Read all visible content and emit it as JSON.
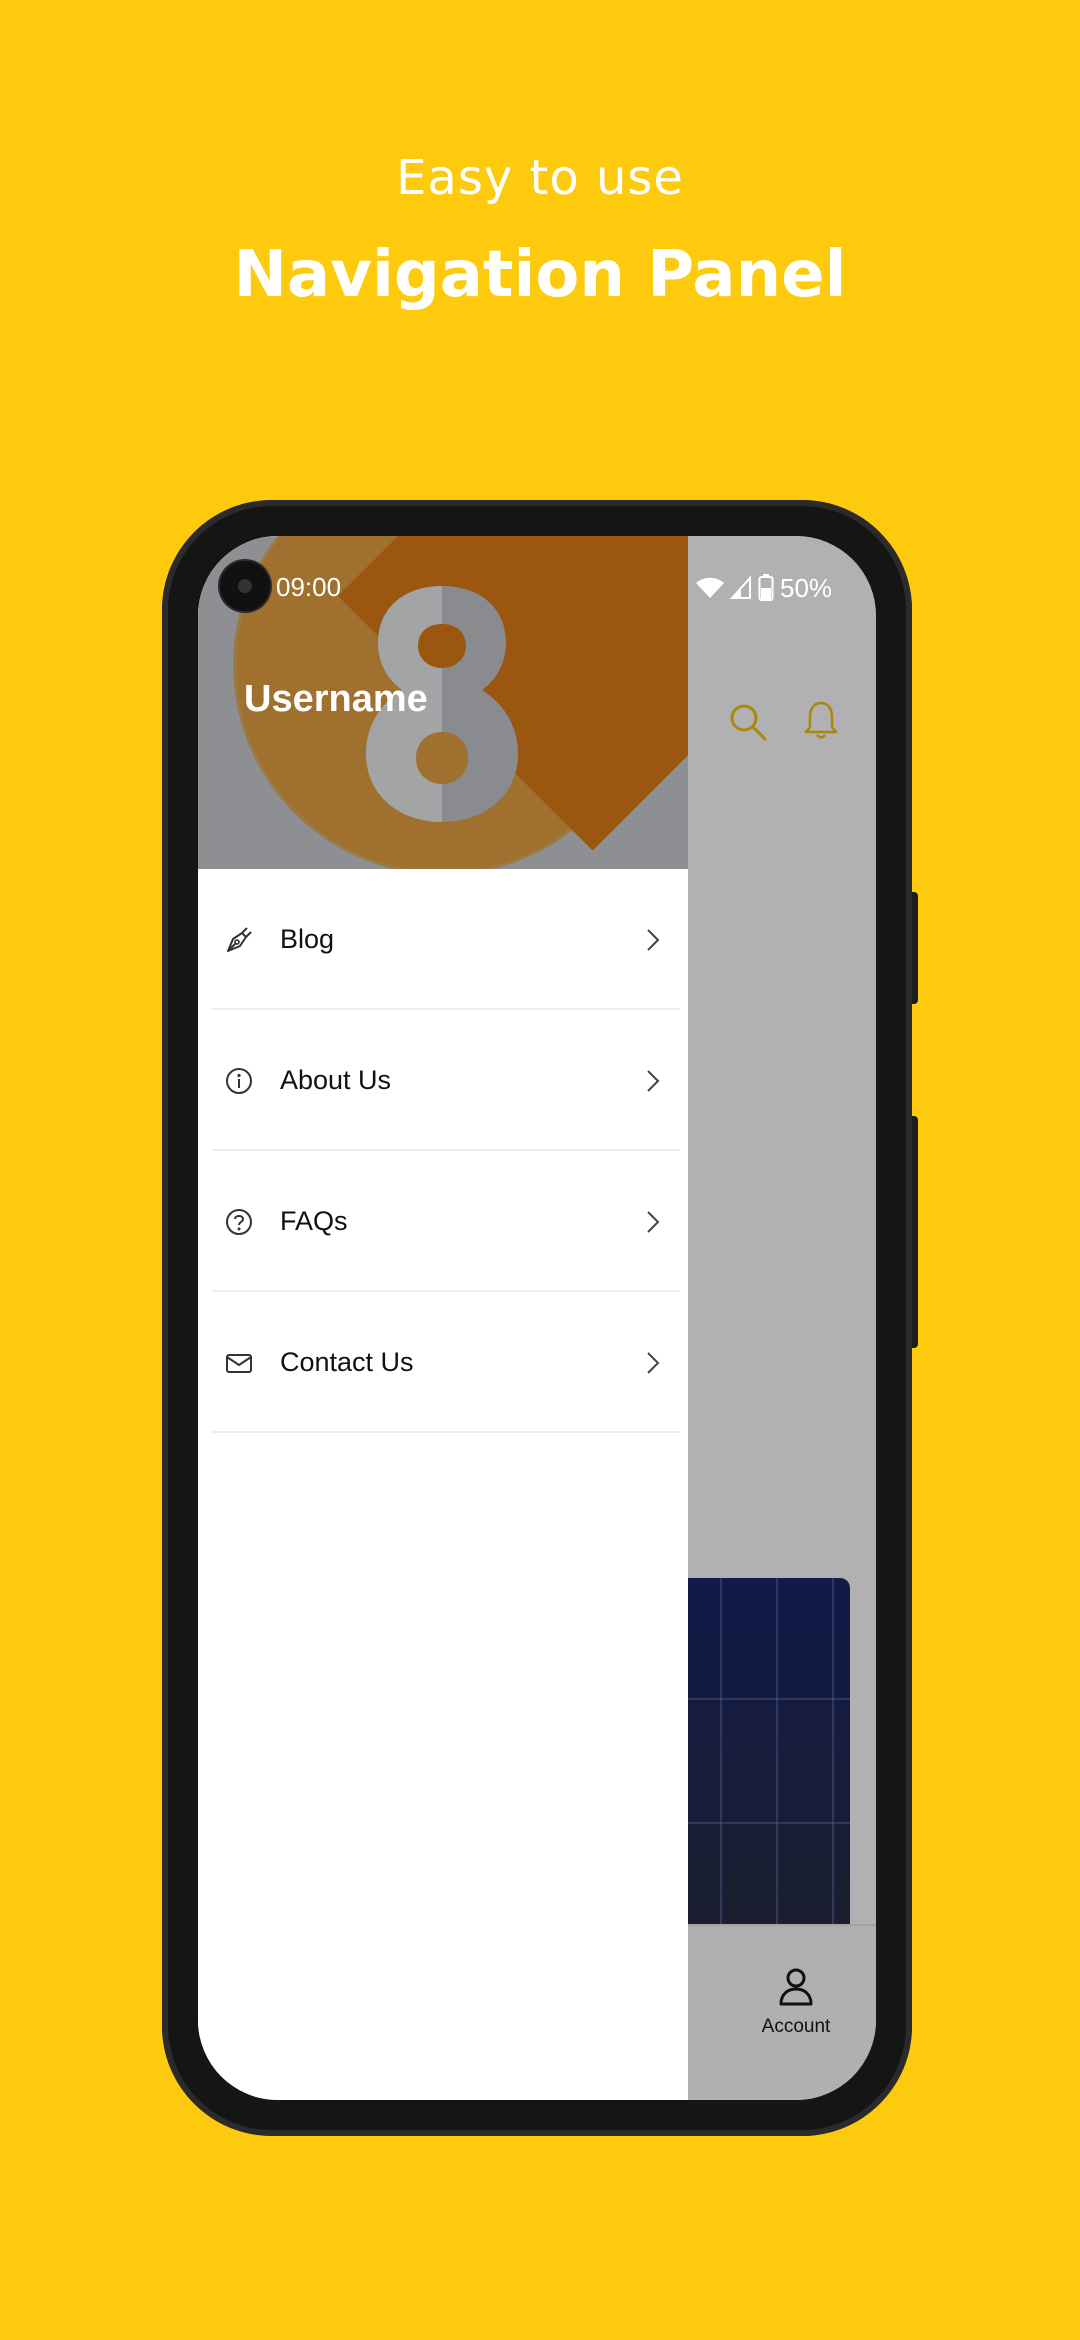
{
  "promo": {
    "subtitle": "Easy to use",
    "title": "Navigation Panel"
  },
  "status_bar": {
    "time": "09:00",
    "battery": "50%"
  },
  "drawer": {
    "username": "Username",
    "items": [
      {
        "label": "Blog",
        "icon": "pen-icon"
      },
      {
        "label": "About Us",
        "icon": "info-icon"
      },
      {
        "label": "FAQs",
        "icon": "question-icon"
      },
      {
        "label": "Contact Us",
        "icon": "mail-icon"
      }
    ]
  },
  "background_app": {
    "bottom_nav": {
      "account_label": "Account"
    }
  },
  "colors": {
    "background": "#FDCA0E",
    "accent_icon": "#A8890A",
    "header_circle": "#A0702F"
  }
}
